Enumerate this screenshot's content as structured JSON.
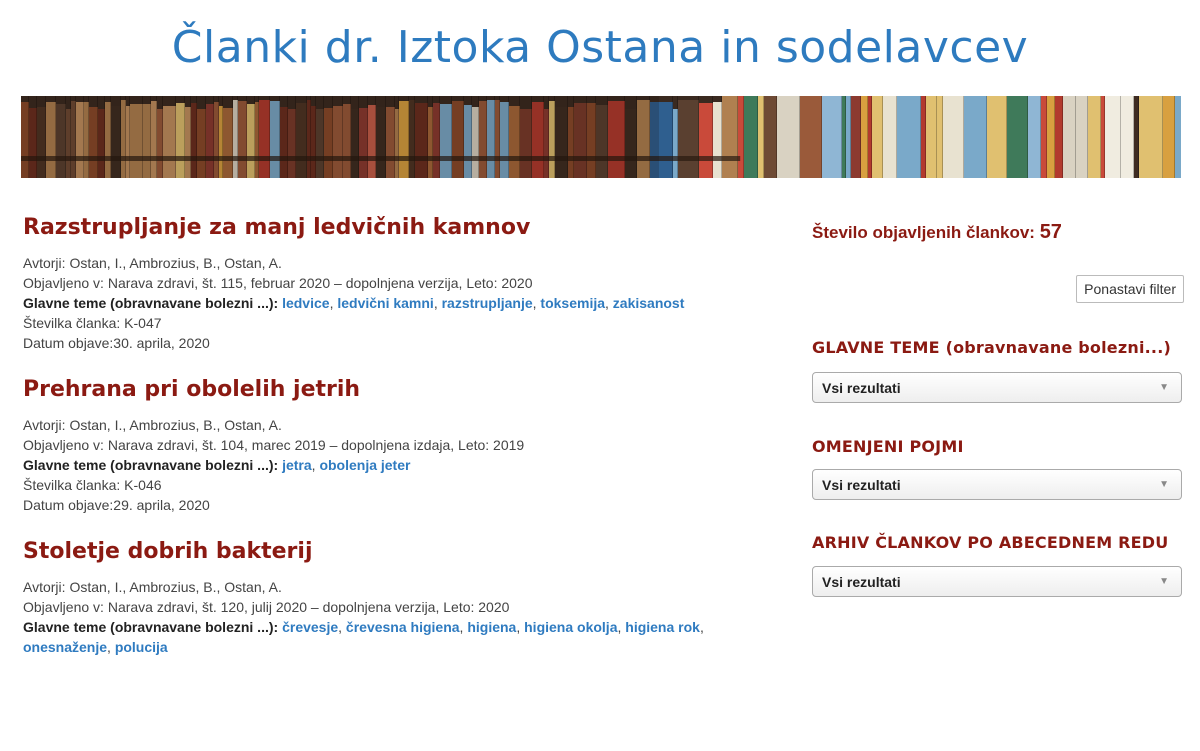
{
  "site": {
    "title": "Članki dr. Iztoka Ostana in sodelavcev"
  },
  "labels": {
    "authors": "Avtorji: ",
    "published_in": "Objavljeno v: ",
    "main_topics": "Glavne teme (obravnavane bolezni ...): ",
    "article_number": "Številka članka: ",
    "publish_date": "Datum objave:"
  },
  "articles": [
    {
      "title": "Razstrupljanje za manj ledvičnih kamnov",
      "authors": "Ostan, I., Ambrozius, B., Ostan, A.",
      "published_in": "Narava zdravi, št. 115, februar 2020 – dopolnjena verzija, Leto: 2020",
      "tags": [
        "ledvice",
        "ledvični kamni",
        "razstrupljanje",
        "toksemija",
        "zakisanost"
      ],
      "number": "K-047",
      "date": "30. aprila, 2020"
    },
    {
      "title": "Prehrana pri obolelih jetrih",
      "authors": "Ostan, I., Ambrozius, B., Ostan, A.",
      "published_in": "Narava zdravi, št. 104, marec 2019 – dopolnjena izdaja, Leto: 2019",
      "tags": [
        "jetra",
        "obolenja jeter"
      ],
      "number": "K-046",
      "date": "29. aprila, 2020"
    },
    {
      "title": "Stoletje dobrih bakterij",
      "authors": "Ostan, I., Ambrozius, B., Ostan, A.",
      "published_in": "Narava zdravi, št. 120, julij 2020 – dopolnjena verzija, Leto: 2020",
      "tags": [
        "črevesje",
        "črevesna higiena",
        "higiena",
        "higiena okolja",
        "higiena rok",
        "onesnaženje",
        "polucija"
      ],
      "number": "",
      "date": ""
    }
  ],
  "sidebar": {
    "count_label": "Število objavljenih člankov: ",
    "count_value": "57",
    "reset_label": "Ponastavi filter",
    "filters": [
      {
        "heading": "GLAVNE TEME (obravnavane bolezni...)",
        "value": "Vsi rezultati"
      },
      {
        "heading": "OMENJENI POJMI",
        "value": "Vsi rezultati"
      },
      {
        "heading": "ARHIV ČLANKOV PO ABECEDNEM REDU",
        "value": "Vsi rezultati"
      }
    ]
  }
}
